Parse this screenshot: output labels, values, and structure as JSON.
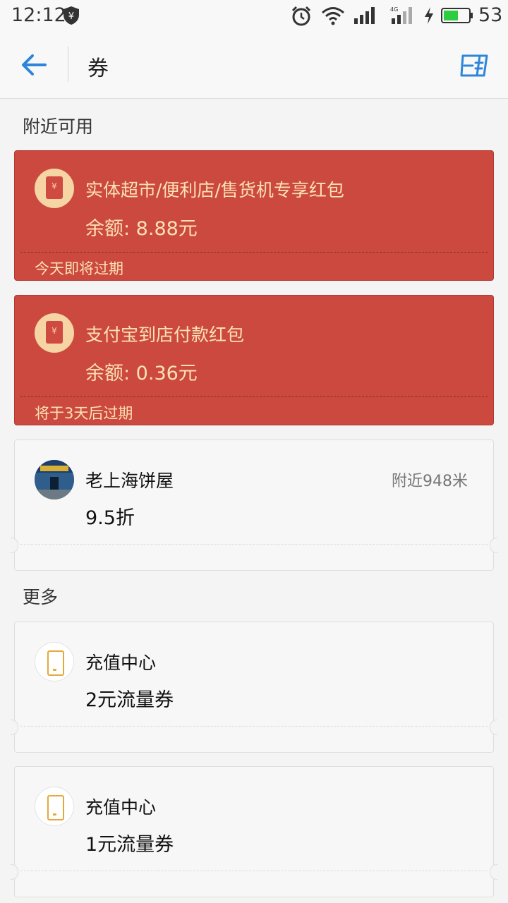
{
  "status_bar": {
    "time": "12:12",
    "battery_percent": "53",
    "icons": [
      "shield-yen-icon",
      "alarm-icon",
      "wifi-icon",
      "signal-icon",
      "signal-4g-icon",
      "charging-icon",
      "battery-icon"
    ]
  },
  "header": {
    "title": "券",
    "back_icon": "arrow-left-icon",
    "action_icon": "scan-code-icon",
    "accent_color": "#2d86d9"
  },
  "sections": {
    "nearby_label": "附近可用",
    "more_label": "更多"
  },
  "red_coupons": [
    {
      "title": "实体超市/便利店/售货机专享红包",
      "amount": "余额: 8.88元",
      "expire": "今天即将过期",
      "icon": "red-envelope-icon"
    },
    {
      "title": "支付宝到店付款红包",
      "amount": "余额: 0.36元",
      "expire": "将于3天后过期",
      "icon": "red-envelope-icon"
    }
  ],
  "nearby_coupons": [
    {
      "title": "老上海饼屋",
      "value": "9.5折",
      "distance": "附近948米",
      "icon": "shop-avatar"
    }
  ],
  "more_coupons": [
    {
      "title": "充值中心",
      "value": "2元流量券",
      "icon": "phone-icon"
    },
    {
      "title": "充值中心",
      "value": "1元流量券",
      "icon": "phone-icon"
    }
  ],
  "colors": {
    "red_card": "#cc493f",
    "red_text": "#fbe1b4",
    "phone_icon": "#e5a93a"
  }
}
